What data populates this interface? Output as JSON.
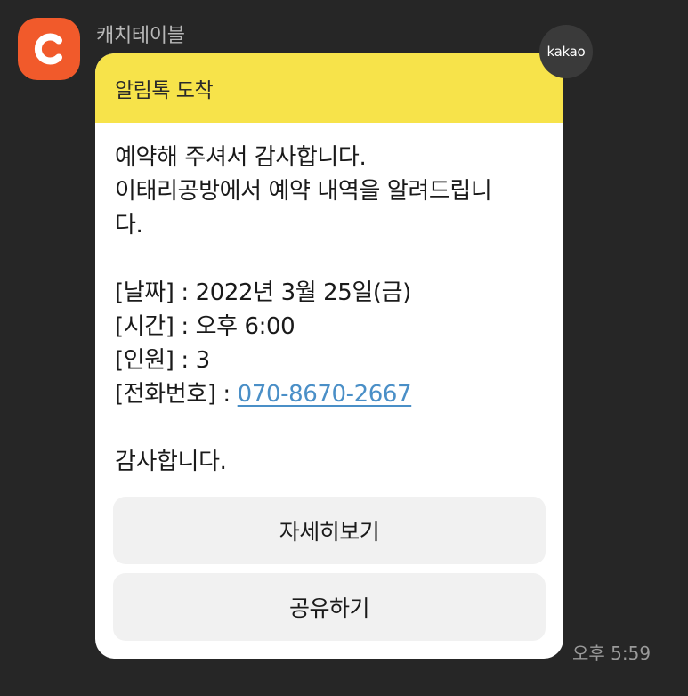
{
  "sender": {
    "name": "캐치테이블",
    "avatar_icon": "catchtable-logo-icon",
    "avatar_color": "#f15a2b"
  },
  "badge": {
    "label": "kakao"
  },
  "message": {
    "header": "알림톡 도착",
    "header_color": "#f7e34a",
    "greeting": "예약해 주셔서 감사합니다.",
    "intro_line1": "이태리공방에서 예약 내역을 알려드립니",
    "intro_line2": "다.",
    "date_label": "[날짜] : ",
    "date_value": "2022년 3월 25일(금)",
    "time_label": "[시간] : ",
    "time_value": "오후 6:00",
    "people_label": "[인원] : ",
    "people_value": "3",
    "phone_label": "[전화번호] : ",
    "phone_value": "070-8670-2667",
    "closing": "감사합니다."
  },
  "buttons": {
    "detail": "자세히보기",
    "share": "공유하기"
  },
  "timestamp": "오후 5:59"
}
